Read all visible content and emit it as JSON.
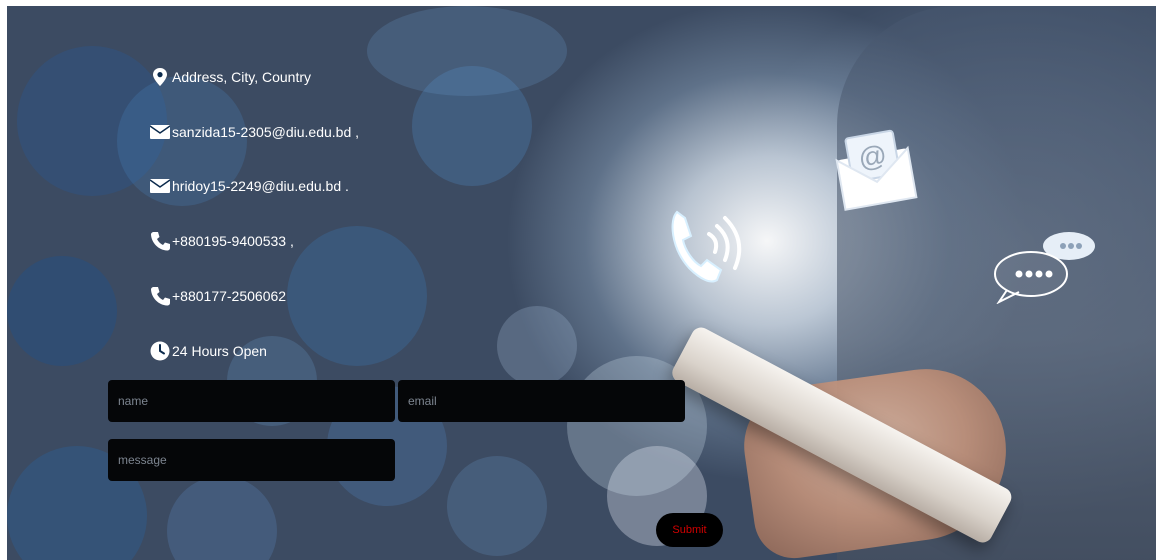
{
  "contact_info": {
    "address": "Address, City, Country",
    "email_1": "sanzida15-2305@diu.edu.bd ,",
    "email_2": "hridoy15-2249@diu.edu.bd .",
    "phone_1": "+880195-9400533 ,",
    "phone_2": "+880177-2506062",
    "hours": "24 Hours Open"
  },
  "form": {
    "name_placeholder": "name",
    "email_placeholder": "email",
    "message_placeholder": "message",
    "submit_label": "Submit"
  },
  "icons": [
    "map-marker-icon",
    "envelope-icon",
    "phone-icon",
    "clock-icon",
    "phone-wave-icon",
    "mail-at-icon",
    "chat-bubble-icon"
  ],
  "colors": {
    "text": "#ffffff",
    "field_bg": "#050608",
    "placeholder": "#7d8590",
    "submit_bg": "#000000",
    "submit_text": "#d10000"
  }
}
